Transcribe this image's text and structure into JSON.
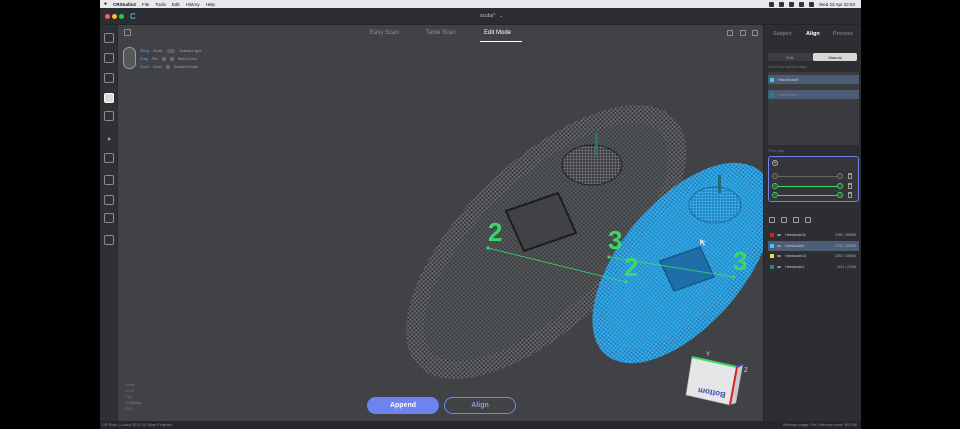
{
  "menubar": {
    "apple": "",
    "items": [
      "CRStudio2",
      "File",
      "Tools",
      "Edit",
      "History",
      "Help"
    ],
    "clock": "Wed 23 Apr 22:53"
  },
  "window": {
    "title": "scuba*"
  },
  "viewport": {
    "tabs": [
      {
        "label": "Easy Scan"
      },
      {
        "label": "Table Scan"
      },
      {
        "label": "Edit Mode"
      }
    ],
    "brush": {
      "row1": {
        "label": "Shrug",
        "mode": "Brush",
        "a": "Selection type"
      },
      "row2": {
        "label": "Drag",
        "mode": "Pan",
        "a": "Select Color"
      },
      "row3": {
        "label": "Scroll",
        "mode": "Zoom",
        "a": "Disable Render"
      }
    },
    "stats": [
      "Points",
      "21.13",
      "1.2k",
      "15.38k fps",
      "33.0"
    ],
    "append_label": "Append",
    "align_label": "Align",
    "markers": [
      "2",
      "3",
      "2",
      "3"
    ],
    "gizmo": {
      "y": "Y",
      "z": "Z",
      "x": "X",
      "face": "Bottom"
    }
  },
  "rightpanel": {
    "tabs": [
      {
        "label": "Subject"
      },
      {
        "label": "Align"
      },
      {
        "label": "Process"
      }
    ],
    "seg": {
      "edit": "Edit",
      "manual": "Manual"
    },
    "hint": "Select two scans to align",
    "targets": [
      {
        "name": "Handscan9",
        "color": "#2ad3f0"
      },
      {
        "name": "Handscan1",
        "color": "#198c7a"
      }
    ],
    "points_label": "Point pairs",
    "point_rows": [
      {
        "a": "1",
        "b": "1"
      },
      {
        "a": "2",
        "b": "2"
      },
      {
        "a": "3",
        "b": "3"
      }
    ],
    "scans": [
      {
        "name": "Handscan11",
        "count": "2058 / 265896",
        "color": "#e01b1b"
      },
      {
        "name": "Handscan9",
        "count": "2795 / 220989",
        "color": "#2ad3f0"
      },
      {
        "name": "Handscan12",
        "count": "2282 / 185906",
        "color": "#f0e22a"
      },
      {
        "name": "Handscan1",
        "count": "1421 / 27448",
        "color": "#198c7a"
      }
    ]
  },
  "status": {
    "left": "CR-Scan | Lizard   22:51:52 Scan Finished",
    "right": "Memory usage: 0%  |  Memory used: 562784"
  },
  "colors": {
    "accent": "#6d83f0",
    "pair_green": "#3bd66a",
    "scan_blue": "#2ba7e6"
  }
}
